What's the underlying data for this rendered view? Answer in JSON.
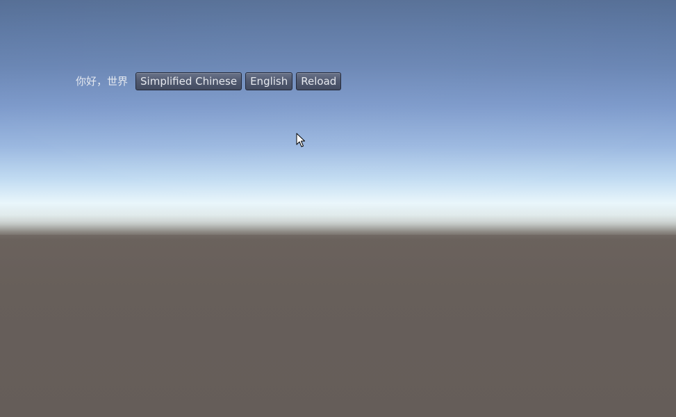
{
  "gui": {
    "greeting_label": "你好，世界",
    "buttons": {
      "simplified_chinese": "Simplified Chinese",
      "english": "English",
      "reload": "Reload"
    }
  },
  "scene": {
    "sky_color_top": "#566f96",
    "horizon_color": "#e9f6fb",
    "ground_color": "#675f5a"
  },
  "cursor": {
    "icon": "arrow-pointer"
  }
}
